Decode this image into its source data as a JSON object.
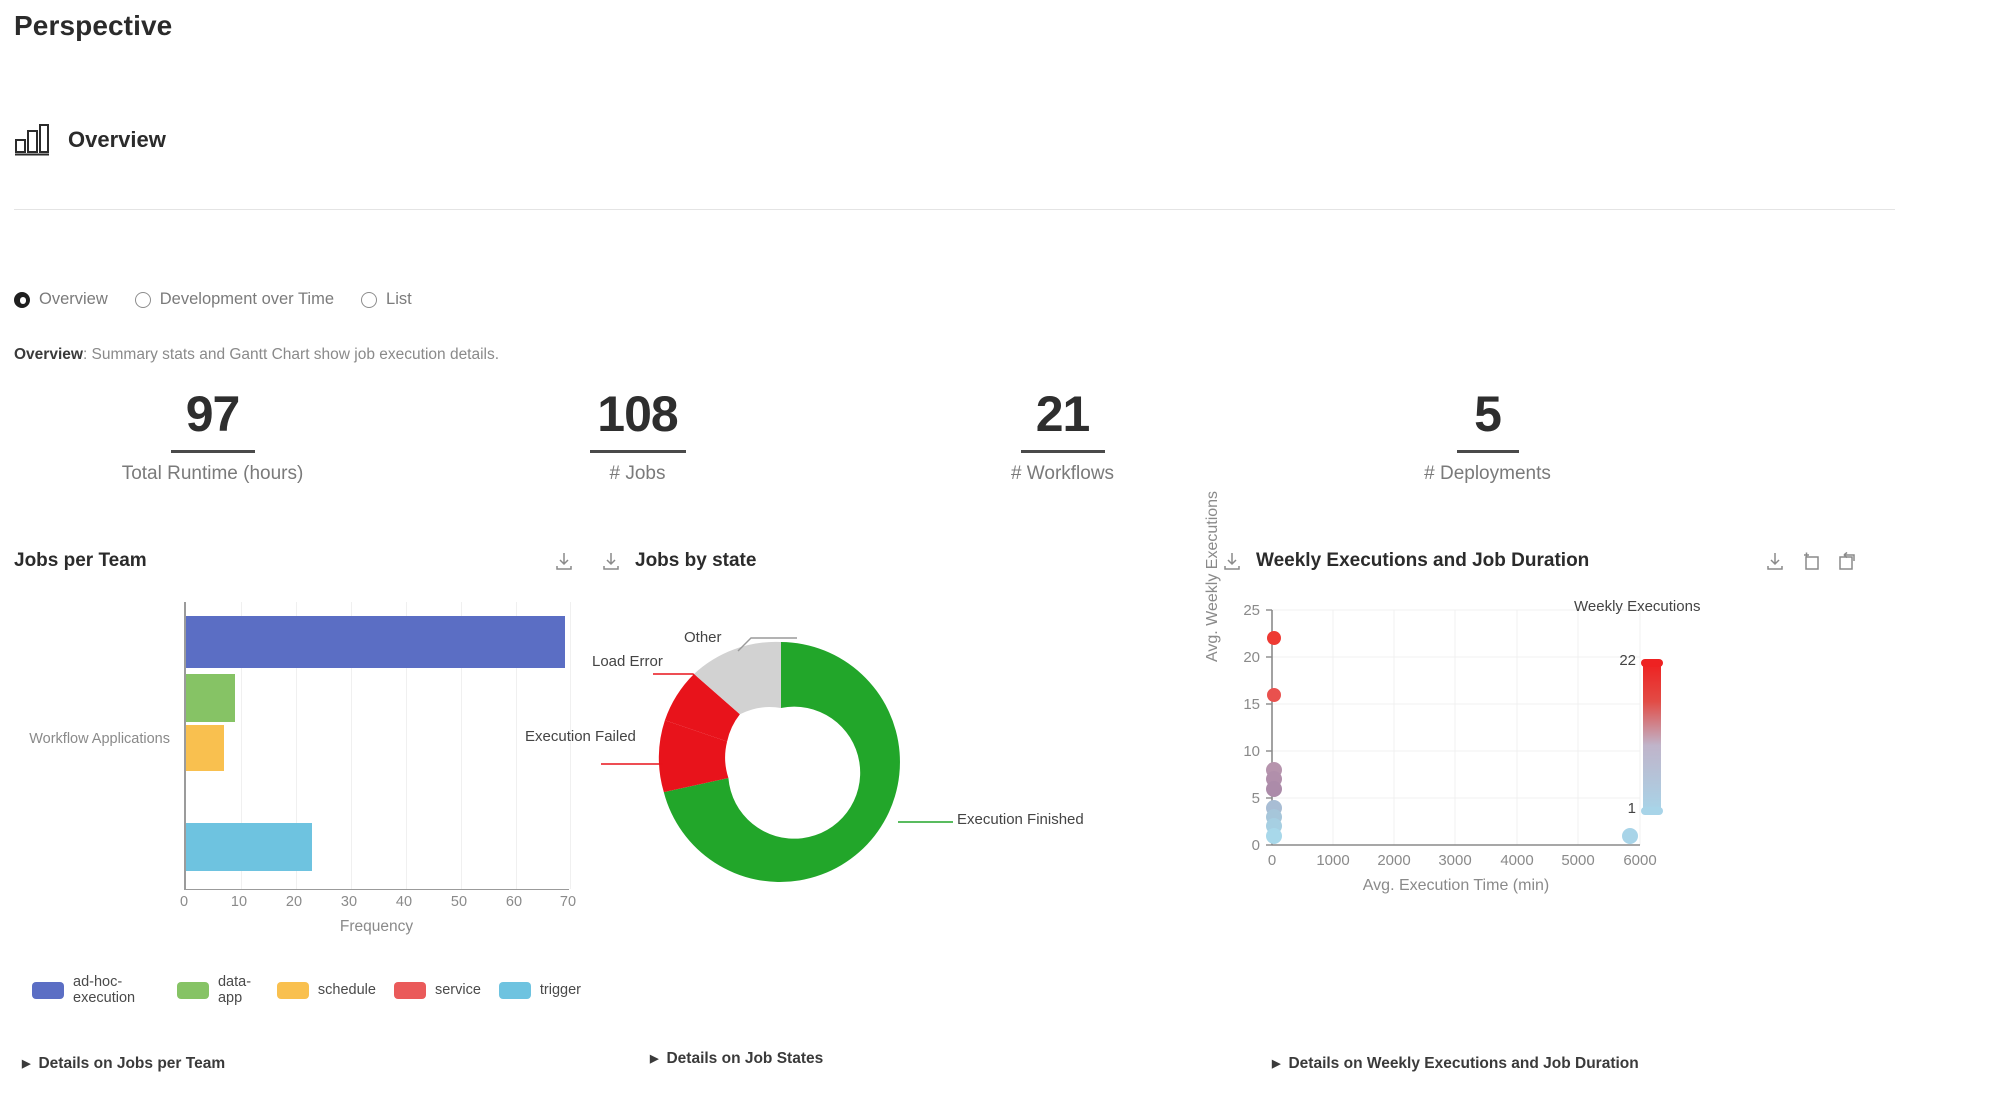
{
  "header": {
    "page_title": "Perspective",
    "section_title": "Overview",
    "section_icon": "bar-chart-icon"
  },
  "view_modes": {
    "selected": "Overview",
    "options": [
      {
        "label": "Overview",
        "selected": true
      },
      {
        "label": "Development over Time",
        "selected": false
      },
      {
        "label": "List",
        "selected": false
      }
    ]
  },
  "description": {
    "strong": "Overview",
    "rest": ": Summary stats and Gantt Chart show job execution details."
  },
  "kpis": [
    {
      "value": "97",
      "label": "Total Runtime (hours)"
    },
    {
      "value": "108",
      "label": "# Jobs"
    },
    {
      "value": "21",
      "label": "# Workflows"
    },
    {
      "value": "5",
      "label": "# Deployments"
    }
  ],
  "panels": {
    "bars": {
      "title": "Jobs per Team",
      "download_icon": "download-icon",
      "details_label": "Details on Jobs per Team"
    },
    "donut": {
      "title": "Jobs by state",
      "download_icon": "download-icon",
      "details_label": "Details on Job States"
    },
    "scatter": {
      "title": "Weekly Executions and Job Duration",
      "download_icon": "download-icon",
      "zoom_icon": "zoom-in-box-icon",
      "reset_icon": "reset-box-icon",
      "details_label": "Details on Weekly Executions and Job Duration"
    }
  },
  "chart_data": [
    {
      "type": "bar",
      "title": "Jobs per Team",
      "orientation": "horizontal",
      "categories": [
        "ad-hoc-execution",
        "data-app",
        "schedule",
        "service",
        "trigger"
      ],
      "values": [
        69,
        9,
        7,
        0,
        23
      ],
      "colors": [
        "#5b6ec4",
        "#86c365",
        "#f9c04f",
        "#ea5a5a",
        "#6ec3e0"
      ],
      "xlabel": "Frequency",
      "ylabel": "",
      "ytick_labels": [
        "Workflow Applications"
      ],
      "xlim": [
        0,
        70
      ],
      "xticks": [
        0,
        10,
        20,
        30,
        40,
        50,
        60,
        70
      ],
      "grid": true,
      "legend_position": "bottom",
      "legend": [
        "ad-hoc-execution",
        "data-app",
        "schedule",
        "service",
        "trigger"
      ]
    },
    {
      "type": "pie",
      "subtype": "donut",
      "title": "Jobs by state",
      "labels": [
        "Execution Finished",
        "Execution Failed",
        "Load Error",
        "Other"
      ],
      "values": [
        72,
        18,
        5,
        5
      ],
      "colors": [
        "#22a62a",
        "#e8131b",
        "#e8131b",
        "#d2d2d2"
      ],
      "annotations": [
        "Other",
        "Load Error",
        "Execution Failed",
        "Execution Finished"
      ]
    },
    {
      "type": "scatter",
      "title": "Weekly Executions and Job Duration",
      "xlabel": "Avg. Execution Time (min)",
      "ylabel": "Avg. Weekly Executions",
      "xlim": [
        0,
        6000
      ],
      "ylim": [
        0,
        25
      ],
      "xticks": [
        0,
        1000,
        2000,
        3000,
        4000,
        5000,
        6000
      ],
      "yticks": [
        0,
        5,
        10,
        15,
        20,
        25
      ],
      "grid": true,
      "points": [
        {
          "x": 20,
          "y": 22
        },
        {
          "x": 20,
          "y": 16
        },
        {
          "x": 20,
          "y": 8
        },
        {
          "x": 20,
          "y": 7
        },
        {
          "x": 20,
          "y": 6
        },
        {
          "x": 20,
          "y": 4
        },
        {
          "x": 20,
          "y": 3
        },
        {
          "x": 20,
          "y": 2
        },
        {
          "x": 20,
          "y": 1
        },
        {
          "x": 5800,
          "y": 1
        }
      ],
      "colorbar": {
        "title": "Weekly Executions",
        "max_label": "22",
        "min_label": "1",
        "max_color": "#ee2222",
        "min_color": "#a8d4e8"
      }
    }
  ]
}
